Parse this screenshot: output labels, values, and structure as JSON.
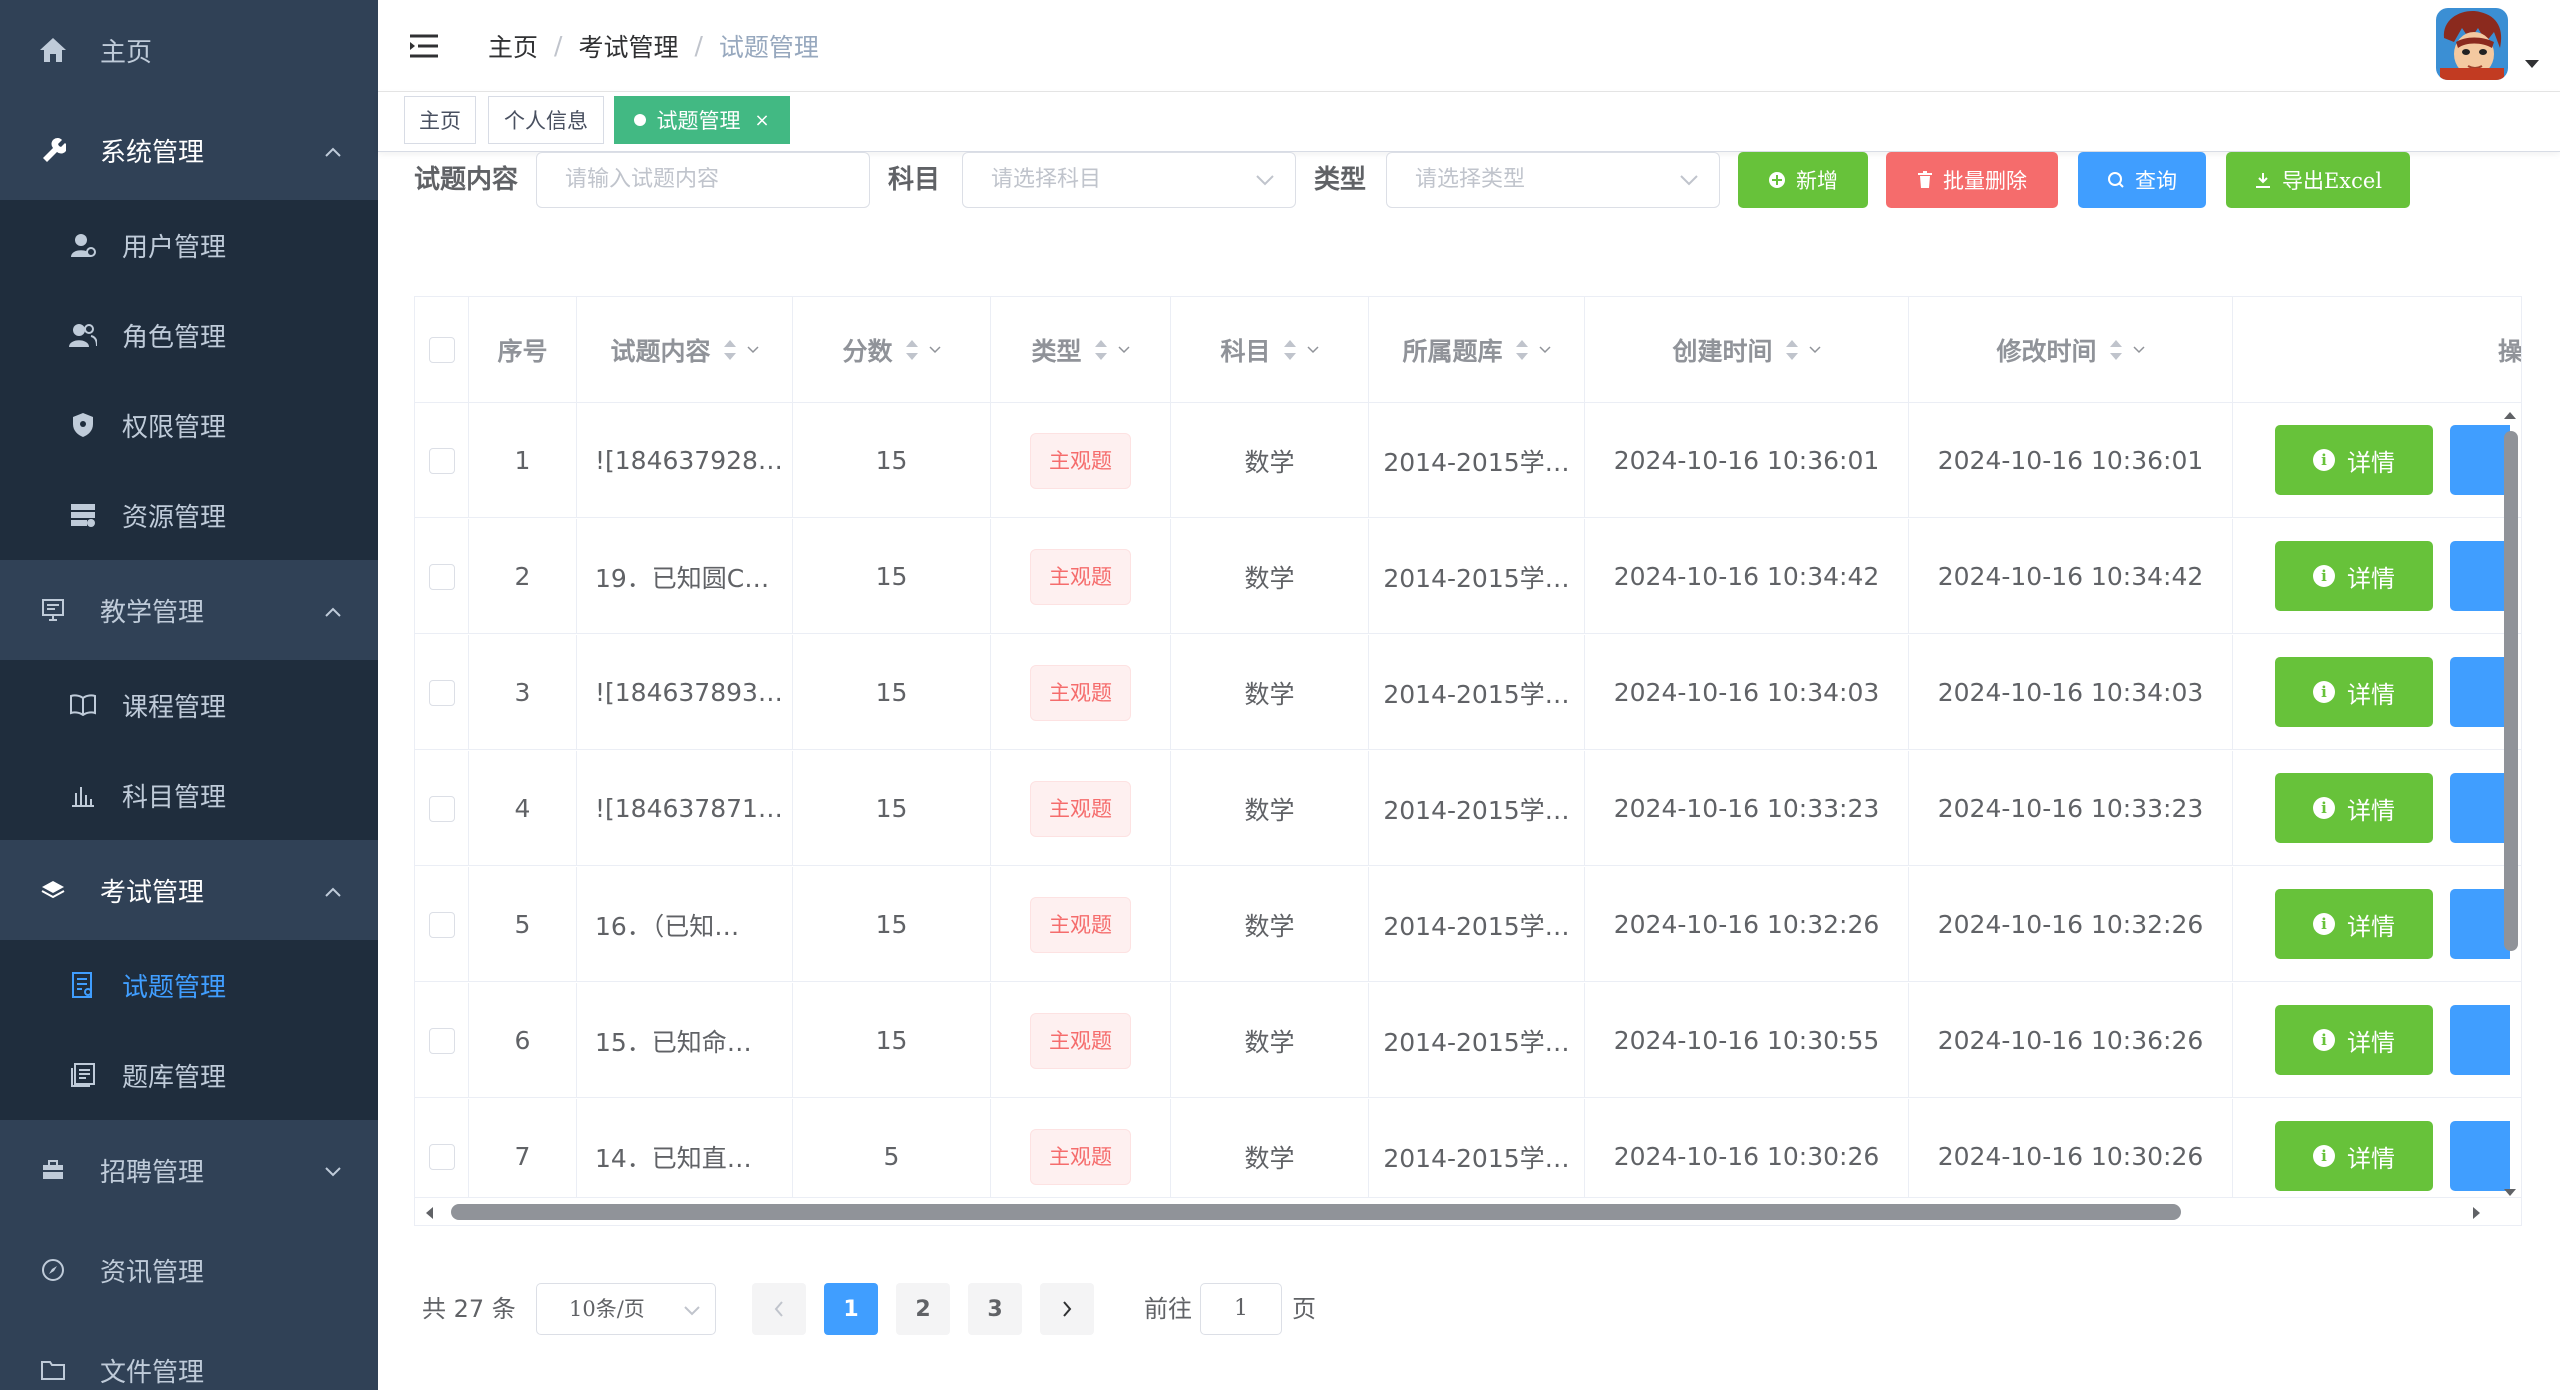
{
  "sidebar": {
    "items": [
      {
        "label": "主页",
        "icon": "home-icon"
      },
      {
        "label": "系统管理",
        "icon": "wrench-icon",
        "expanded": true
      },
      {
        "label": "用户管理",
        "icon": "user-icon"
      },
      {
        "label": "角色管理",
        "icon": "users-icon"
      },
      {
        "label": "权限管理",
        "icon": "shield-icon"
      },
      {
        "label": "资源管理",
        "icon": "server-icon"
      },
      {
        "label": "教学管理",
        "icon": "board-icon",
        "expanded": true
      },
      {
        "label": "课程管理",
        "icon": "book-icon"
      },
      {
        "label": "科目管理",
        "icon": "bars-icon"
      },
      {
        "label": "考试管理",
        "icon": "layers-icon",
        "expanded": true
      },
      {
        "label": "试题管理",
        "icon": "form-icon",
        "active": true
      },
      {
        "label": "题库管理",
        "icon": "doc-icon"
      },
      {
        "label": "招聘管理",
        "icon": "briefcase-icon",
        "expanded": false
      },
      {
        "label": "资讯管理",
        "icon": "compass-icon"
      },
      {
        "label": "文件管理",
        "icon": "folder-icon"
      }
    ]
  },
  "header": {
    "breadcrumb": [
      "主页",
      "考试管理",
      "试题管理"
    ]
  },
  "tags": [
    {
      "label": "主页",
      "active": false
    },
    {
      "label": "个人信息",
      "active": false
    },
    {
      "label": "试题管理",
      "active": true,
      "close": "×"
    }
  ],
  "search": {
    "content_label": "试题内容",
    "content_placeholder": "请输入试题内容",
    "subject_label": "科目",
    "subject_placeholder": "请选择科目",
    "type_label": "类型",
    "type_placeholder": "请选择类型",
    "add_label": "新增",
    "batch_delete_label": "批量删除",
    "query_label": "查询",
    "export_label": "导出Excel"
  },
  "table": {
    "columns": [
      "序号",
      "试题内容",
      "分数",
      "类型",
      "科目",
      "所属题库",
      "创建时间",
      "修改时间",
      "操"
    ],
    "detail_label": "详情",
    "rows": [
      {
        "index": "1",
        "content": "![184637928…",
        "score": "15",
        "type": "主观题",
        "subject": "数学",
        "bank": "2014-2015学…",
        "created": "2024-10-16 10:36:01",
        "modified": "2024-10-16 10:36:01"
      },
      {
        "index": "2",
        "content": "19．已知圆C…",
        "score": "15",
        "type": "主观题",
        "subject": "数学",
        "bank": "2014-2015学…",
        "created": "2024-10-16 10:34:42",
        "modified": "2024-10-16 10:34:42"
      },
      {
        "index": "3",
        "content": "![184637893…",
        "score": "15",
        "type": "主观题",
        "subject": "数学",
        "bank": "2014-2015学…",
        "created": "2024-10-16 10:34:03",
        "modified": "2024-10-16 10:34:03"
      },
      {
        "index": "4",
        "content": "![184637871…",
        "score": "15",
        "type": "主观题",
        "subject": "数学",
        "bank": "2014-2015学…",
        "created": "2024-10-16 10:33:23",
        "modified": "2024-10-16 10:33:23"
      },
      {
        "index": "5",
        "content": "16．（已知…",
        "score": "15",
        "type": "主观题",
        "subject": "数学",
        "bank": "2014-2015学…",
        "created": "2024-10-16 10:32:26",
        "modified": "2024-10-16 10:32:26"
      },
      {
        "index": "6",
        "content": "15．已知命…",
        "score": "15",
        "type": "主观题",
        "subject": "数学",
        "bank": "2014-2015学…",
        "created": "2024-10-16 10:30:55",
        "modified": "2024-10-16 10:36:26"
      },
      {
        "index": "7",
        "content": "14．已知直…",
        "score": "5",
        "type": "主观题",
        "subject": "数学",
        "bank": "2014-2015学…",
        "created": "2024-10-16 10:30:26",
        "modified": "2024-10-16 10:30:26"
      }
    ]
  },
  "pagination": {
    "total": "共 27 条",
    "page_size": "10条/页",
    "pages": [
      "1",
      "2",
      "3"
    ],
    "current": "1",
    "goto_label": "前往",
    "goto_value": "1",
    "page_suffix": "页"
  },
  "colors": {
    "sidebar_bg": "#304156",
    "sidebar_sub_bg": "#1f2d3d",
    "active_tag": "#42b983",
    "primary": "#409eff",
    "success": "#67c23a",
    "danger": "#f56c6c"
  }
}
